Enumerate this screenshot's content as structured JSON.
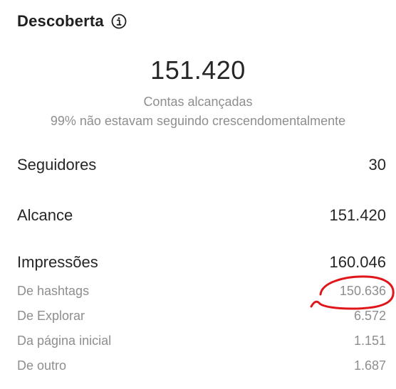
{
  "header": {
    "title": "Descoberta",
    "info_icon": "info-circle-icon"
  },
  "summary": {
    "reach_value": "151.420",
    "reach_caption": "Contas alcançadas",
    "not_following_caption": "99% não estavam seguindo crescendomentalmente"
  },
  "metrics": [
    {
      "label": "Seguidores",
      "value": "30"
    },
    {
      "label": "Alcance",
      "value": "151.420"
    },
    {
      "label": "Impressões",
      "value": "160.046"
    }
  ],
  "impressions_breakdown": [
    {
      "label": "De hashtags",
      "value": "150.636"
    },
    {
      "label": "De Explorar",
      "value": "6.572"
    },
    {
      "label": "Da página inicial",
      "value": "1.151"
    },
    {
      "label": "De outro",
      "value": "1.687"
    }
  ],
  "colors": {
    "annotation_stroke": "#e0161b",
    "secondary_text": "#8e8e8e",
    "primary_text": "#262626"
  }
}
